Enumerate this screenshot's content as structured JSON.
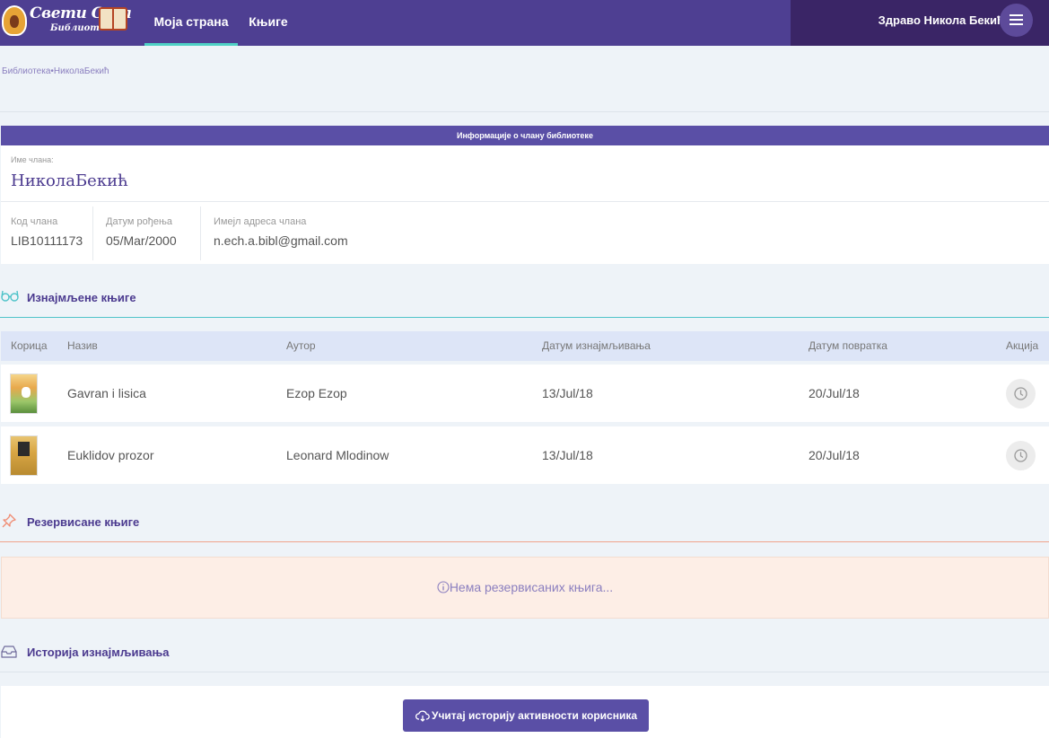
{
  "brand": {
    "name_line1": "Свети Сава",
    "name_line2": "Библиотека"
  },
  "nav": {
    "items": [
      {
        "label": "Моја страна",
        "active": true
      },
      {
        "label": "Књиге",
        "active": false
      }
    ],
    "greeting": "Здраво Никола Бекић"
  },
  "breadcrumb": {
    "root": "Библиотека",
    "separator": "•",
    "current": "НиколаБекић"
  },
  "member": {
    "card_title": "Информације о члану библиотеке",
    "name_label": "Име члана:",
    "name": "НиколаБекић",
    "fields": [
      {
        "label": "Код члана",
        "value": "LIB10111173"
      },
      {
        "label": "Датум рођења",
        "value": "05/Mar/2000"
      },
      {
        "label": "Имејл адреса члана",
        "value": "n.ech.a.bibl@gmail.com"
      }
    ]
  },
  "rented": {
    "title": "Изнајмљене књиге",
    "columns": [
      "Корица",
      "Назив",
      "Аутор",
      "Датум изнајмљивања",
      "Датум повратка",
      "Акција"
    ],
    "rows": [
      {
        "title": "Gavran i lisica",
        "author": "Ezop Ezop",
        "rented": "13/Jul/18",
        "returned": "20/Jul/18"
      },
      {
        "title": "Euklidov prozor",
        "author": "Leonard Mlodinow",
        "rented": "13/Jul/18",
        "returned": "20/Jul/18"
      }
    ]
  },
  "reserved": {
    "title": "Резервисане књиге",
    "empty_message": "Нема резервисаних књига..."
  },
  "history": {
    "title": "Историја изнајмљивања",
    "load_button": "Учитај историју активности корисника"
  },
  "colors": {
    "nav_bg": "#4e3f92",
    "accent": "#5a4fa6",
    "teal": "#4fd1c5",
    "reserved_bg": "#fdeee6"
  }
}
